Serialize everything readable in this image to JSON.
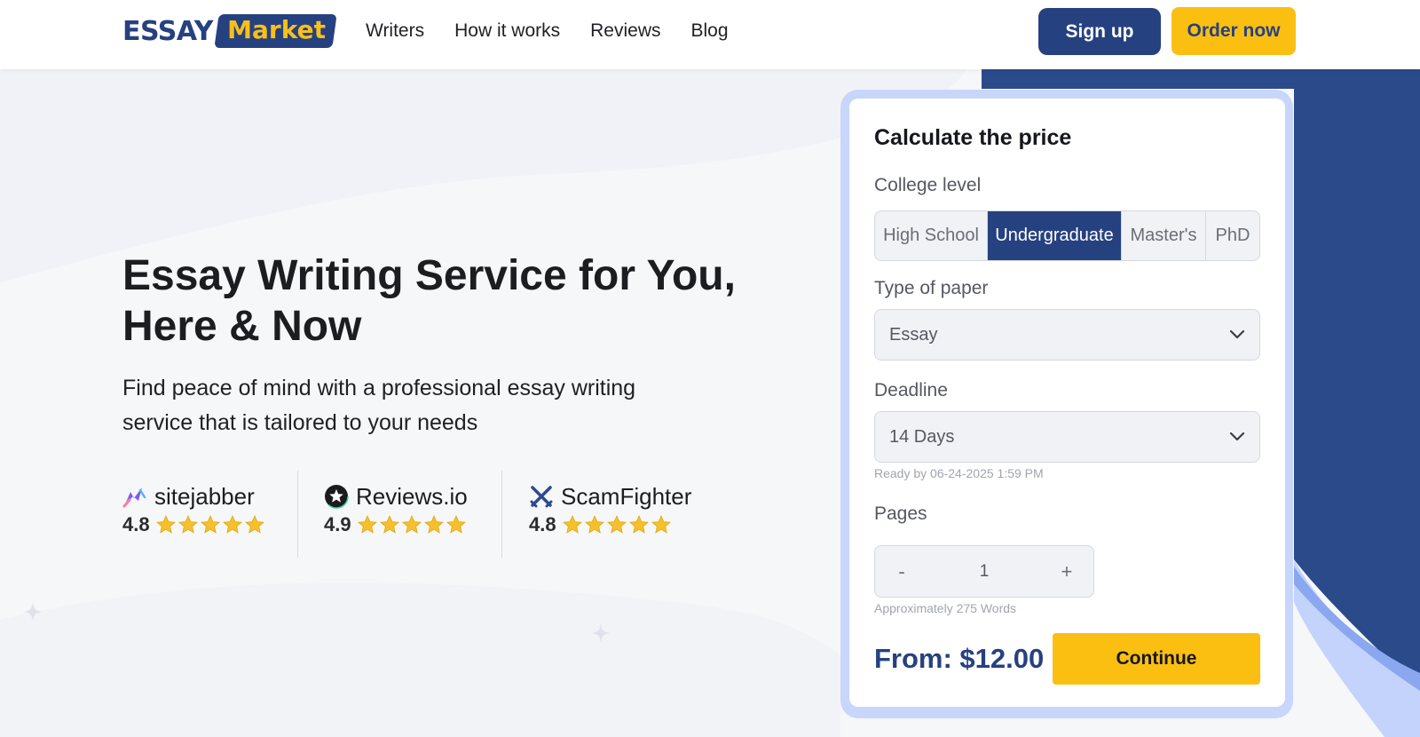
{
  "header": {
    "logo": {
      "part1": "ESSAY",
      "part2": "Market"
    },
    "nav": [
      {
        "label": "Writers"
      },
      {
        "label": "How it works"
      },
      {
        "label": "Reviews"
      },
      {
        "label": "Blog"
      }
    ],
    "signup_label": "Sign up",
    "order_label": "Order now"
  },
  "hero": {
    "title_line1": "Essay Writing Service for You,",
    "title_line2": "Here & Now",
    "subtitle_line1": "Find peace of mind with a professional essay writing",
    "subtitle_line2": "service that is tailored to your needs"
  },
  "ratings": [
    {
      "brand": "sitejabber",
      "score": "4.8",
      "stars": 5,
      "icon": "sitejabber-icon"
    },
    {
      "brand": "Reviews.io",
      "score": "4.9",
      "stars": 5,
      "icon": "reviewsio-icon"
    },
    {
      "brand": "ScamFighter",
      "score": "4.8",
      "stars": 5,
      "icon": "scamfighter-icon"
    }
  ],
  "calculator": {
    "title": "Calculate the price",
    "college_label": "College level",
    "levels": [
      {
        "label": "High School",
        "active": false
      },
      {
        "label": "Undergraduate",
        "active": true
      },
      {
        "label": "Master's",
        "active": false
      },
      {
        "label": "PhD",
        "active": false
      }
    ],
    "paper_label": "Type of paper",
    "paper_value": "Essay",
    "deadline_label": "Deadline",
    "deadline_value": "14 Days",
    "ready_by": "Ready by 06-24-2025 1:59 PM",
    "pages_label": "Pages",
    "pages_value": "1",
    "minus": "-",
    "plus": "+",
    "words_hint": "Approximately 275 Words",
    "price": "From: $12.00",
    "continue_label": "Continue"
  },
  "colors": {
    "brand_blue": "#26417f",
    "accent_yellow": "#fbbf12",
    "star_gold": "#f5c02b"
  }
}
